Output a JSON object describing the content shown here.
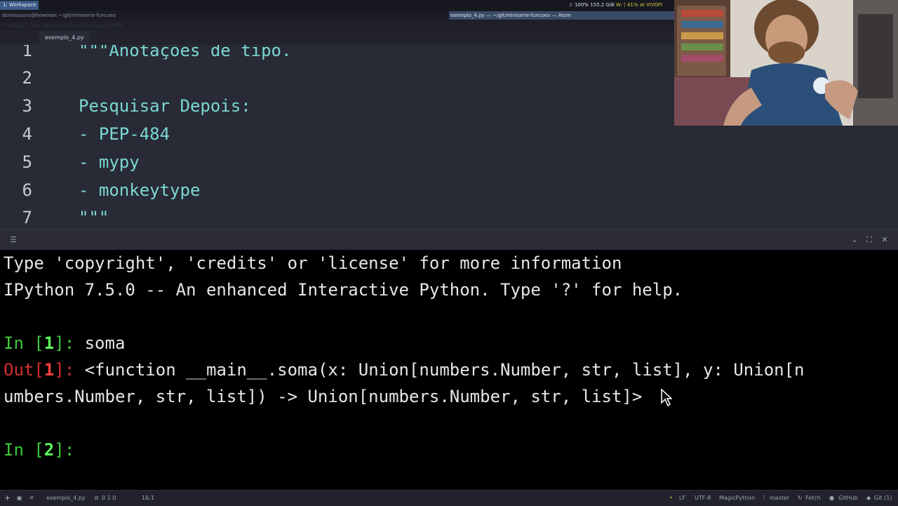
{
  "topbar": {
    "workspace": "1: Workspace",
    "cpu": "/: 100%",
    "disk": "155.2 GiB",
    "wifi": "W: ( 41% at VIVOFI"
  },
  "windows": {
    "terminal_title": "dunossauro@bowman:~/git/miniserie-funcoes",
    "atom_title": "exemplo_4.py — ~/git/miniserie-funcoes — Atom"
  },
  "editor": {
    "menu_ghost": "File  Edit  View  Selection  Find  Packages  Help",
    "tab_label": "exemplo_4.py",
    "lines": [
      {
        "num": "1",
        "text": "\"\"\"Anotações de tipo."
      },
      {
        "num": "2",
        "text": ""
      },
      {
        "num": "3",
        "text": "Pesquisar Depois:"
      },
      {
        "num": "4",
        "text": "- PEP-484"
      },
      {
        "num": "5",
        "text": "- mypy"
      },
      {
        "num": "6",
        "text": "- monkeytype"
      },
      {
        "num": "7",
        "text": "\"\"\""
      }
    ]
  },
  "terminal": {
    "line1": "Type 'copyright', 'credits' or 'license' for more information",
    "line2": "IPython 7.5.0 -- An enhanced Interactive Python. Type '?' for help.",
    "in1_prefix": "In [",
    "in1_num": "1",
    "in1_suffix": "]: ",
    "in1_cmd": "soma",
    "out1_prefix": "Out[",
    "out1_num": "1",
    "out1_suffix": "]: ",
    "out1_text": "<function __main__.soma(x: Union[numbers.Number, str, list], y: Union[n",
    "out1_wrap": "umbers.Number, str, list]) -> Union[numbers.Number, str, list]>",
    "in2_prefix": "In [",
    "in2_num": "2",
    "in2_suffix": "]: "
  },
  "statusbar": {
    "file": "exemplo_4.py",
    "diagnostics": "0  1  0",
    "cursor": "16:1",
    "eol": "LF",
    "encoding": "UTF-8",
    "grammar": "MagicPython",
    "branch": "master",
    "fetch": "Fetch",
    "github": "GitHub",
    "git": "Git (1)"
  },
  "colors": {
    "editor_bg": "#282a36",
    "code_text": "#7bd8d2",
    "prompt_green": "#5cff5c",
    "prompt_red": "#ff3e3e"
  }
}
